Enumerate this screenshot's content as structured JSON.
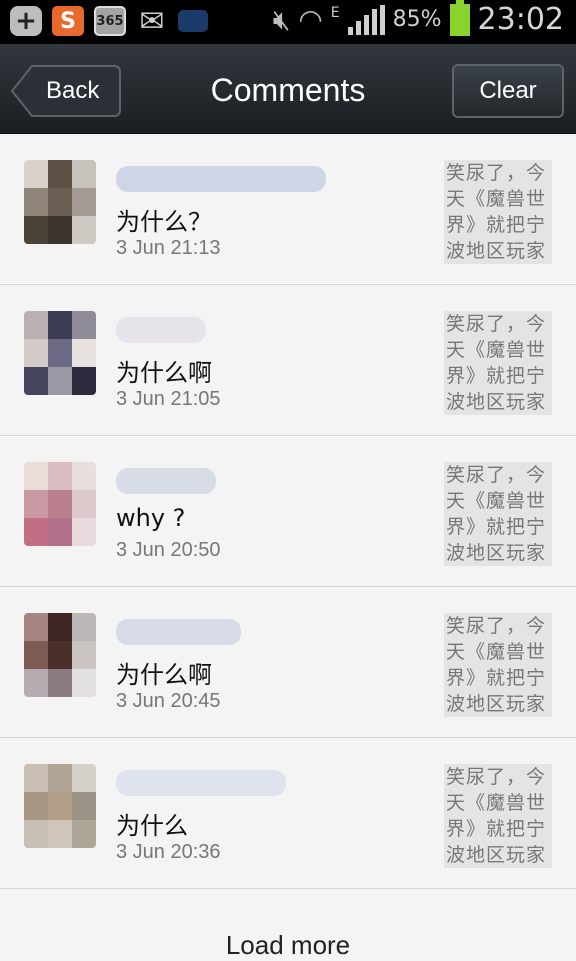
{
  "status_bar": {
    "battery_pct": "85%",
    "time": "23:02",
    "network": "E",
    "icons": [
      "add-icon",
      "sogou-icon",
      "calendar-365-icon",
      "mail-icon",
      "message-icon",
      "mute-icon",
      "wifi-icon",
      "signal-icon",
      "battery-icon"
    ]
  },
  "header": {
    "back_label": "Back",
    "title": "Comments",
    "clear_label": "Clear"
  },
  "comments": [
    {
      "text": "为什么？",
      "time": "3 Jun  21:13",
      "quote": "笑尿了，今天《魔兽世界》就把宁波地区玩家",
      "avatar_colors": [
        "#d9d2cc",
        "#5d5044",
        "#c8c2bc",
        "#8e8478",
        "#6b5e52",
        "#a39b94",
        "#4b4238",
        "#3b342d",
        "#cfc9c3"
      ]
    },
    {
      "text": "为什么啊",
      "time": "3 Jun  21:05",
      "quote": "笑尿了，今天《魔兽世界》就把宁波地区玩家",
      "avatar_colors": [
        "#b9b0b4",
        "#3c3c57",
        "#8f8a97",
        "#d2cbc8",
        "#6c6a84",
        "#e7e2df",
        "#45445e",
        "#9c97a5",
        "#2c2b3d"
      ]
    },
    {
      "text": "why ?",
      "time": "3 Jun  20:50",
      "quote": "笑尿了，今天《魔兽世界》就把宁波地区玩家",
      "avatar_colors": [
        "#eadcd6",
        "#d8bcc0",
        "#e7dfdc",
        "#c99aa3",
        "#b97f8c",
        "#ddc8cc",
        "#c26e84",
        "#b3708a",
        "#ead9dd"
      ]
    },
    {
      "text": "为什么啊",
      "time": "3 Jun  20:45",
      "quote": "笑尿了，今天《魔兽世界》就把宁波地区玩家",
      "avatar_colors": [
        "#a58581",
        "#3e2524",
        "#bcb7b6",
        "#7c5b55",
        "#4a2f2a",
        "#cac4c3",
        "#b6abb0",
        "#8b7b80",
        "#e3e0e2"
      ]
    },
    {
      "text": "为什么",
      "time": "3 Jun  20:36",
      "quote": "笑尿了，今天《魔兽世界》就把宁波地区玩家",
      "avatar_colors": [
        "#c9bfb3",
        "#b3a595",
        "#d6d1c8",
        "#a69682",
        "#b29f88",
        "#9c9486",
        "#c7bfb1",
        "#cfc6b9",
        "#aea696"
      ]
    }
  ],
  "footer": {
    "load_more_label": "Load more"
  }
}
